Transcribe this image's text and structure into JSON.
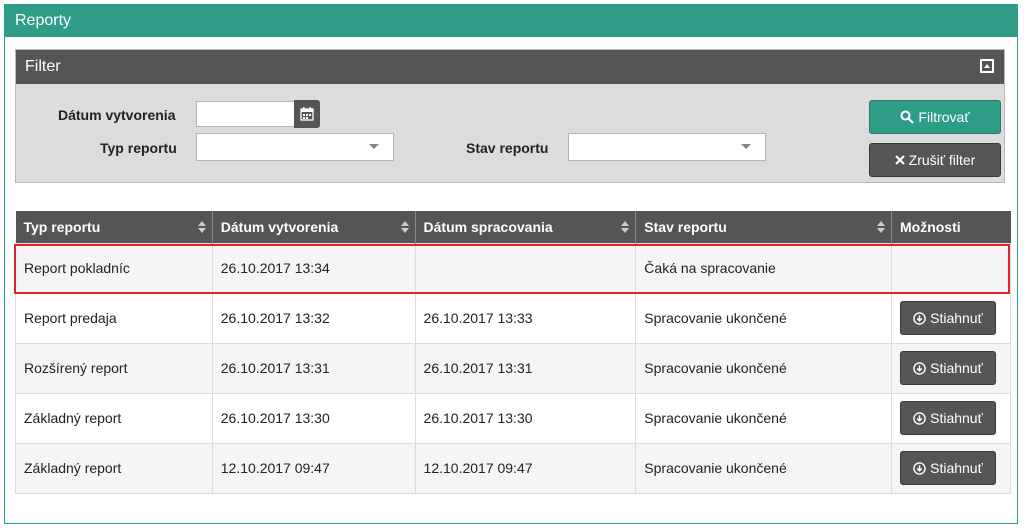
{
  "panel": {
    "title": "Reporty"
  },
  "filter": {
    "title": "Filter",
    "date_label": "Dátum vytvorenia",
    "date_value": "",
    "type_label": "Typ reportu",
    "type_value": "",
    "state_label": "Stav reportu",
    "state_value": "",
    "filter_button": "Filtrovať",
    "clear_button": "Zrušiť filter"
  },
  "table": {
    "columns": [
      "Typ reportu",
      "Dátum vytvorenia",
      "Dátum spracovania",
      "Stav reportu",
      "Možnosti"
    ],
    "download_label": "Stiahnuť",
    "rows": [
      {
        "type": "Report pokladníc",
        "created": "26.10.2017 13:34",
        "processed": "",
        "state": "Čaká na spracovanie",
        "download": false
      },
      {
        "type": "Report predaja",
        "created": "26.10.2017 13:32",
        "processed": "26.10.2017 13:33",
        "state": "Spracovanie ukončené",
        "download": true
      },
      {
        "type": "Rozšírený report",
        "created": "26.10.2017 13:31",
        "processed": "26.10.2017 13:31",
        "state": "Spracovanie ukončené",
        "download": true
      },
      {
        "type": "Základný report",
        "created": "26.10.2017 13:30",
        "processed": "26.10.2017 13:30",
        "state": "Spracovanie ukončené",
        "download": true
      },
      {
        "type": "Základný report",
        "created": "12.10.2017 09:47",
        "processed": "12.10.2017 09:47",
        "state": "Spracovanie ukončené",
        "download": true
      }
    ]
  },
  "colors": {
    "accent": "#2f9c87",
    "dark": "#555555",
    "highlight": "#d9252b"
  }
}
